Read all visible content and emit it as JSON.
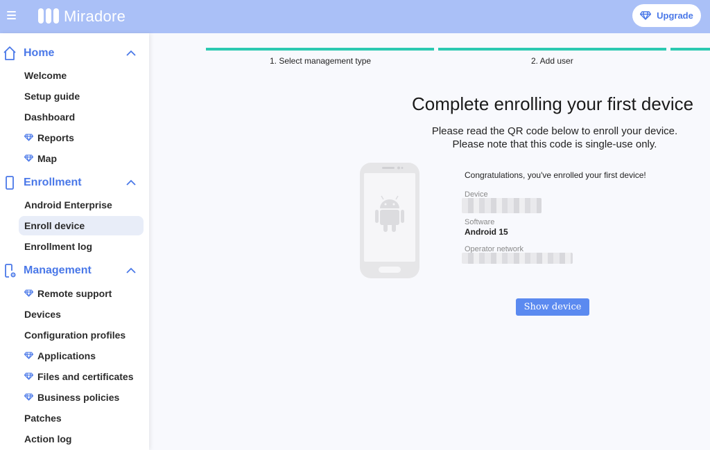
{
  "header": {
    "brand": "Miradore",
    "upgrade_label": "Upgrade"
  },
  "sidebar": {
    "sections": [
      {
        "title": "Home",
        "icon": "home-icon",
        "items": [
          {
            "label": "Welcome",
            "premium": false
          },
          {
            "label": "Setup guide",
            "premium": false
          },
          {
            "label": "Dashboard",
            "premium": false
          },
          {
            "label": "Reports",
            "premium": true
          },
          {
            "label": "Map",
            "premium": true
          }
        ]
      },
      {
        "title": "Enrollment",
        "icon": "smartphone-icon",
        "items": [
          {
            "label": "Android Enterprise",
            "premium": false
          },
          {
            "label": "Enroll device",
            "premium": false,
            "active": true
          },
          {
            "label": "Enrollment log",
            "premium": false
          }
        ]
      },
      {
        "title": "Management",
        "icon": "device-settings-icon",
        "items": [
          {
            "label": "Remote support",
            "premium": true
          },
          {
            "label": "Devices",
            "premium": false
          },
          {
            "label": "Configuration profiles",
            "premium": false
          },
          {
            "label": "Applications",
            "premium": true
          },
          {
            "label": "Files and certificates",
            "premium": true
          },
          {
            "label": "Business policies",
            "premium": true
          },
          {
            "label": "Patches",
            "premium": false
          },
          {
            "label": "Action log",
            "premium": false
          }
        ]
      }
    ]
  },
  "stepper": {
    "steps": [
      {
        "label": "1. Select management type"
      },
      {
        "label": "2. Add user"
      }
    ]
  },
  "main": {
    "title": "Complete enrolling your first device",
    "subtitle_line1": "Please read the QR code below to enroll your device.",
    "subtitle_line2": "Please note that this code is single-use only.",
    "congrats": "Congratulations, you've enrolled your first device!",
    "device_label": "Device",
    "software_label": "Software",
    "software_value": "Android 15",
    "operator_label": "Operator network",
    "show_device_label": "Show device"
  },
  "colors": {
    "header_bg": "#aac0f7",
    "accent": "#4a78e8",
    "step_bar": "#2cc9b1",
    "button": "#5b8af0"
  }
}
